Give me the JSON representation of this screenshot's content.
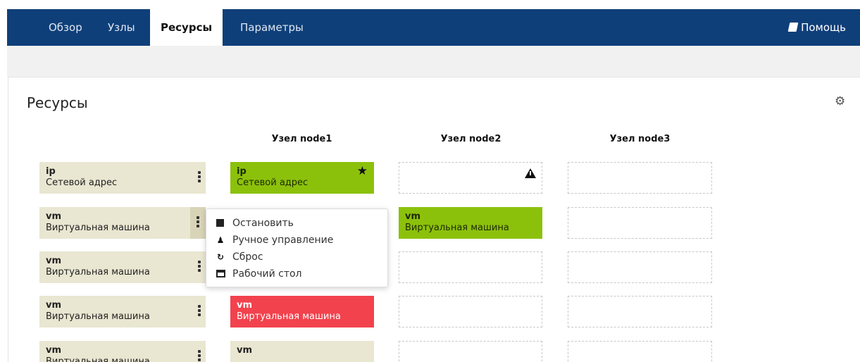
{
  "nav": {
    "tabs": [
      {
        "label": "Обзор"
      },
      {
        "label": "Узлы"
      },
      {
        "label": "Ресурсы"
      },
      {
        "label": "Параметры"
      }
    ],
    "active_tab": "Ресурсы",
    "help_label": "Помощь"
  },
  "page": {
    "title": "Ресурсы",
    "settings_icon": "gear-icon"
  },
  "columns": [
    "Узел node1",
    "Узел node2",
    "Узел node3"
  ],
  "rows": [
    {
      "name": "ip",
      "desc": "Сетевой адрес",
      "nodes": [
        {
          "state": "running",
          "name": "ip",
          "desc": "Сетевой адрес",
          "marker": "star-icon"
        },
        {
          "state": "empty",
          "marker": "warning-icon"
        },
        {
          "state": "empty"
        }
      ]
    },
    {
      "name": "vm",
      "desc": "Виртуальная машина",
      "nodes": [
        {
          "state": "hidden-by-menu"
        },
        {
          "state": "running",
          "name": "vm",
          "desc": "Виртуальная машина"
        },
        {
          "state": "empty"
        }
      ]
    },
    {
      "name": "vm",
      "desc": "Виртуальная машина",
      "nodes": [
        {
          "state": "hidden-by-menu"
        },
        {
          "state": "empty"
        },
        {
          "state": "empty"
        }
      ]
    },
    {
      "name": "vm",
      "desc": "Виртуальная машина",
      "nodes": [
        {
          "state": "failed",
          "name": "vm",
          "desc": "Виртуальная машина"
        },
        {
          "state": "empty"
        },
        {
          "state": "empty"
        }
      ]
    },
    {
      "name": "vm",
      "desc": "Виртуальная машина",
      "nodes": [
        {
          "state": "stopped",
          "name": "vm",
          "desc": ""
        },
        {
          "state": "empty"
        },
        {
          "state": "empty"
        }
      ]
    }
  ],
  "context_menu": {
    "items": [
      {
        "label": "Остановить",
        "icon": "stop-icon"
      },
      {
        "label": "Ручное управление",
        "icon": "user-icon"
      },
      {
        "label": "Сброс",
        "icon": "refresh-icon"
      },
      {
        "label": "Рабочий стол",
        "icon": "desktop-icon"
      }
    ]
  },
  "colors": {
    "nav_bg": "#0f3f79",
    "resource_bg": "#e9e6d1",
    "running": "#8cc10b",
    "failed": "#f2424d"
  }
}
